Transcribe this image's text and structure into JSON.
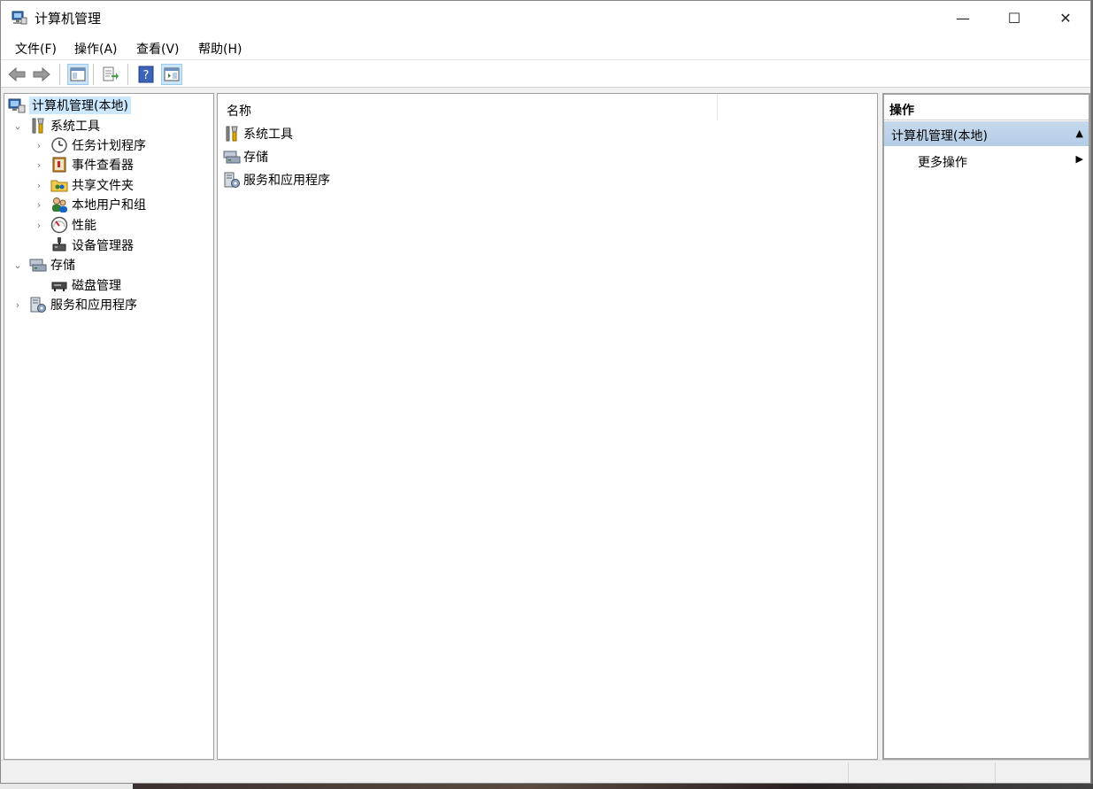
{
  "window": {
    "title": "计算机管理",
    "controls": {
      "minimize": "—",
      "maximize": "☐",
      "close": "✕"
    }
  },
  "menu": [
    "文件(F)",
    "操作(A)",
    "查看(V)",
    "帮助(H)"
  ],
  "toolbar": {
    "buttons": [
      "back-arrow-icon",
      "forward-arrow-icon",
      "show-hide-console-tree-icon",
      "export-list-icon",
      "help-icon",
      "show-hide-action-pane-icon"
    ]
  },
  "tree": {
    "root": "计算机管理(本地)",
    "system_tools": "系统工具",
    "task_scheduler": "任务计划程序",
    "event_viewer": "事件查看器",
    "shared_folders": "共享文件夹",
    "local_users": "本地用户和组",
    "performance": "性能",
    "device_manager": "设备管理器",
    "storage": "存储",
    "disk_management": "磁盘管理",
    "services_apps": "服务和应用程序",
    "expand_open": "⌄",
    "expand_closed": "›"
  },
  "list": {
    "column_name": "名称",
    "items": [
      "系统工具",
      "存储",
      "服务和应用程序"
    ]
  },
  "actions": {
    "header": "操作",
    "group": "计算机管理(本地)",
    "group_toggle": "▲",
    "more": "更多操作",
    "more_arrow": "▶"
  }
}
